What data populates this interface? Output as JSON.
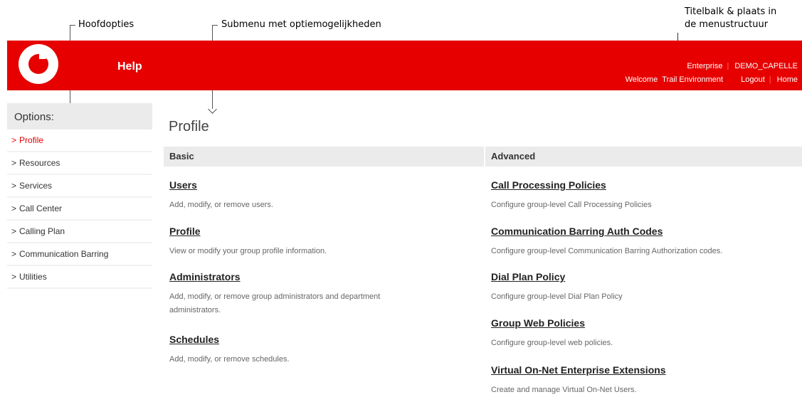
{
  "annotations": {
    "main_options": "Hoofdopties",
    "submenu": "Submenu met optiemogelijkheden",
    "title_bar_line1": "Titelbalk & plaats in",
    "title_bar_line2": "de menustructuur"
  },
  "header": {
    "help": "Help",
    "enterprise": "Enterprise",
    "group": "DEMO_CAPELLE",
    "welcome": "Welcome",
    "user": "Trail Environment",
    "logout": "Logout",
    "home": "Home"
  },
  "sidebar": {
    "heading": "Options:",
    "items": [
      {
        "label": "Profile",
        "active": true
      },
      {
        "label": "Resources"
      },
      {
        "label": "Services"
      },
      {
        "label": "Call Center"
      },
      {
        "label": "Calling Plan"
      },
      {
        "label": "Communication Barring"
      },
      {
        "label": "Utilities"
      }
    ]
  },
  "main": {
    "title": "Profile",
    "basic": {
      "heading": "Basic",
      "entries": [
        {
          "title": "Users",
          "desc": "Add, modify, or remove users."
        },
        {
          "title": "Profile",
          "desc": "View or modify your group profile information."
        },
        {
          "title": "Administrators",
          "desc": "Add, modify, or remove group administrators and department administrators."
        },
        {
          "title": "Schedules",
          "desc": "Add, modify, or remove schedules."
        }
      ]
    },
    "advanced": {
      "heading": "Advanced",
      "entries": [
        {
          "title": "Call Processing Policies",
          "desc": "Configure group-level Call Processing Policies"
        },
        {
          "title": "Communication Barring Auth Codes",
          "desc": "Configure group-level Communication Barring Authorization codes."
        },
        {
          "title": "Dial Plan Policy",
          "desc": "Configure group-level Dial Plan Policy"
        },
        {
          "title": "Group Web Policies",
          "desc": "Configure group-level web policies."
        },
        {
          "title": "Virtual On-Net Enterprise Extensions",
          "desc": "Create and manage Virtual On-Net Users."
        }
      ]
    }
  },
  "colors": {
    "brand_red": "#e60000",
    "active_item": "#e60000"
  }
}
